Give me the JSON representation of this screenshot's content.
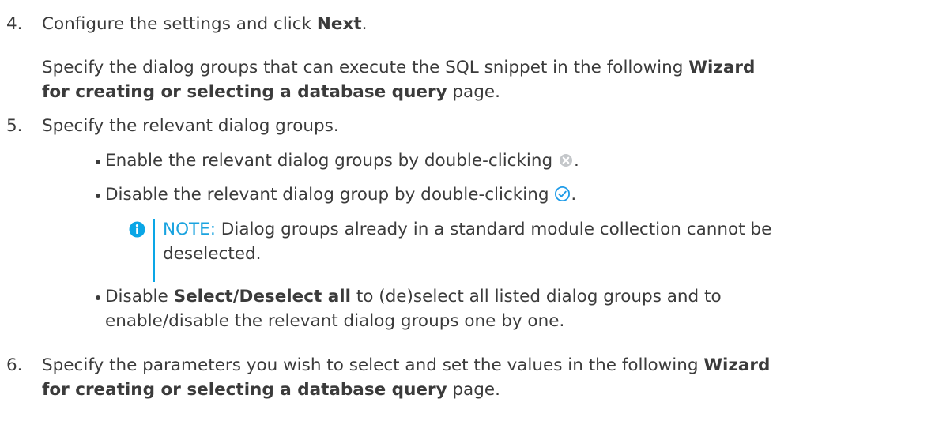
{
  "steps": {
    "s4": {
      "number": "4.",
      "line1_pre": "Configure the settings and click ",
      "line1_bold": "Next",
      "line1_post": ".",
      "p_pre": "Specify the dialog groups that can execute the SQL snippet in the following ",
      "p_bold1": "Wizard",
      "p_bold2": "for creating or selecting a database query",
      "p_post": " page."
    },
    "s5": {
      "number": "5.",
      "text": "Specify the relevant dialog groups.",
      "bullets": [
        {
          "text": "Enable the relevant dialog groups by double-clicking ",
          "icon": "disabled-x-icon",
          "post": "."
        },
        {
          "text": "Disable the relevant dialog group by double-clicking ",
          "icon": "enabled-check-icon",
          "post": "."
        }
      ],
      "note": {
        "label": "NOTE:",
        "line1": " Dialog groups already in a standard module collection cannot be",
        "line2": "deselected.",
        "icon": "info-icon"
      },
      "bullet3": {
        "pre": "Disable ",
        "bold": "Select/Deselect all",
        "post": " to (de)select all listed dialog groups and to",
        "line2": "enable/disable the relevant dialog groups one by one."
      }
    },
    "s6": {
      "number": "6.",
      "line1_pre": "Specify the parameters you wish to select and set the values in the following ",
      "line1_bold": "Wizard",
      "line2_bold": "for creating or selecting a database query",
      "line2_post": " page."
    }
  },
  "colors": {
    "text": "#3b3b3b",
    "note": "#1aa3df",
    "accent_blue": "#0aa6e6"
  }
}
